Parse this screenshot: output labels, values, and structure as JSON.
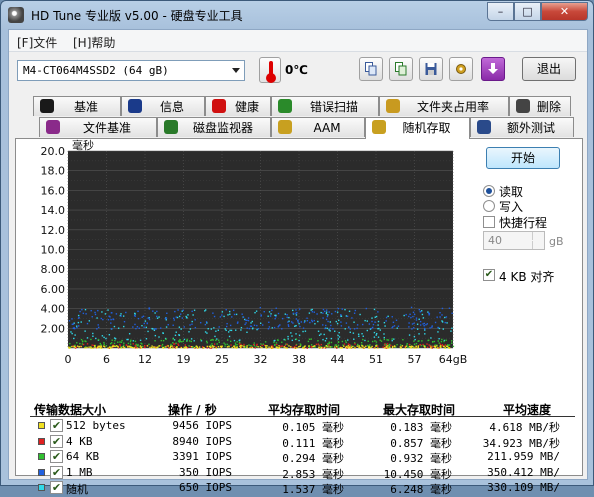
{
  "window": {
    "title": "HD Tune 专业版 v5.00 - 硬盘专业工具",
    "minimize": "–",
    "maximize": "□",
    "close": "✕"
  },
  "menu": {
    "file": "[F]文件",
    "help": "[H]帮助"
  },
  "toolbar": {
    "drive": "M4-CT064M4SSD2 (64 gB)",
    "temperature": "0℃",
    "exit": "退出",
    "buttons": [
      "copy-icon",
      "copy-all-icon",
      "save-icon",
      "settings-icon",
      "download-icon"
    ]
  },
  "tabs_top": [
    {
      "label": "基准",
      "icon": "bulb-icon",
      "color": "#1a1a1a"
    },
    {
      "label": "信息",
      "icon": "info-icon",
      "color": "#1a3a8a"
    },
    {
      "label": "健康",
      "icon": "health-cross-icon",
      "color": "#d01010"
    },
    {
      "label": "错误扫描",
      "icon": "magnifier-icon",
      "color": "#2a8a2a"
    },
    {
      "label": "文件夹占用率",
      "icon": "folder-icon",
      "color": "#c89a20"
    },
    {
      "label": "删除",
      "icon": "trash-icon",
      "color": "#444444"
    }
  ],
  "tabs_bottom": [
    {
      "label": "文件基准",
      "icon": "file-bulb-icon",
      "color": "#8a2a8a"
    },
    {
      "label": "磁盘监视器",
      "icon": "bar-monitor-icon",
      "color": "#2a7a2a"
    },
    {
      "label": "AAM",
      "icon": "speaker-icon",
      "color": "#c8a020"
    },
    {
      "label": "随机存取",
      "icon": "random-access-icon",
      "color": "#c8a020",
      "active": true
    },
    {
      "label": "额外测试",
      "icon": "extra-test-icon",
      "color": "#2a4a8a"
    }
  ],
  "controls": {
    "start": "开始",
    "read": "读取",
    "write": "写入",
    "mode": "read",
    "short_stroke": "快捷行程",
    "short_stroke_checked": false,
    "stroke_value": "40",
    "stroke_unit": "gB",
    "align_4kb": "4 KB 对齐",
    "align_4kb_checked": true
  },
  "chart_data": {
    "type": "scatter",
    "ylabel": "毫秒",
    "ylim": [
      0,
      20
    ],
    "yticks": [
      "20.0",
      "18.0",
      "16.0",
      "14.0",
      "12.0",
      "10.0",
      "8.00",
      "6.00",
      "4.00",
      "2.00"
    ],
    "xlim": [
      0,
      64
    ],
    "xticks": [
      "0",
      "6",
      "12",
      "19",
      "25",
      "32",
      "38",
      "44",
      "51",
      "57",
      "64gB"
    ],
    "background": "#2b2b2b",
    "grid": true,
    "series": [
      {
        "name": "512 bytes",
        "color": "#f0e020",
        "band": [
          0.05,
          0.3
        ],
        "density": "high"
      },
      {
        "name": "4 KB",
        "color": "#e02020",
        "band": [
          0.05,
          0.5
        ],
        "density": "medium"
      },
      {
        "name": "64 KB",
        "color": "#30c030",
        "band": [
          0.15,
          1.0
        ],
        "density": "high"
      },
      {
        "name": "1 MB",
        "color": "#2060e0",
        "band": [
          2.0,
          4.2
        ],
        "density": "high"
      },
      {
        "name": "随机",
        "color": "#30d8e8",
        "band": [
          0.8,
          4.0
        ],
        "density": "high"
      }
    ]
  },
  "table": {
    "headers": [
      "传输数据大小",
      "操作 / 秒",
      "平均存取时间",
      "最大存取时间",
      "平均速度"
    ],
    "rows": [
      {
        "size": "512 bytes",
        "color": "#f0e020",
        "checked": true,
        "iops": "9456 IOPS",
        "avg": "0.105 毫秒",
        "max": "0.183 毫秒",
        "speed": "4.618 MB/秒"
      },
      {
        "size": "4 KB",
        "color": "#e02020",
        "checked": true,
        "iops": "8940 IOPS",
        "avg": "0.111 毫秒",
        "max": "0.857 毫秒",
        "speed": "34.923 MB/秒"
      },
      {
        "size": "64 KB",
        "color": "#30c030",
        "checked": true,
        "iops": "3391 IOPS",
        "avg": "0.294 毫秒",
        "max": "0.932 毫秒",
        "speed": "211.959 MB/"
      },
      {
        "size": "1 MB",
        "color": "#2060e0",
        "checked": true,
        "iops": "350 IOPS",
        "avg": "2.853 毫秒",
        "max": "10.450 毫秒",
        "speed": "350.412 MB/"
      },
      {
        "size": "随机",
        "color": "#30d8e8",
        "checked": true,
        "iops": "650 IOPS",
        "avg": "1.537 毫秒",
        "max": "6.248 毫秒",
        "speed": "330.109 MB/"
      }
    ]
  }
}
